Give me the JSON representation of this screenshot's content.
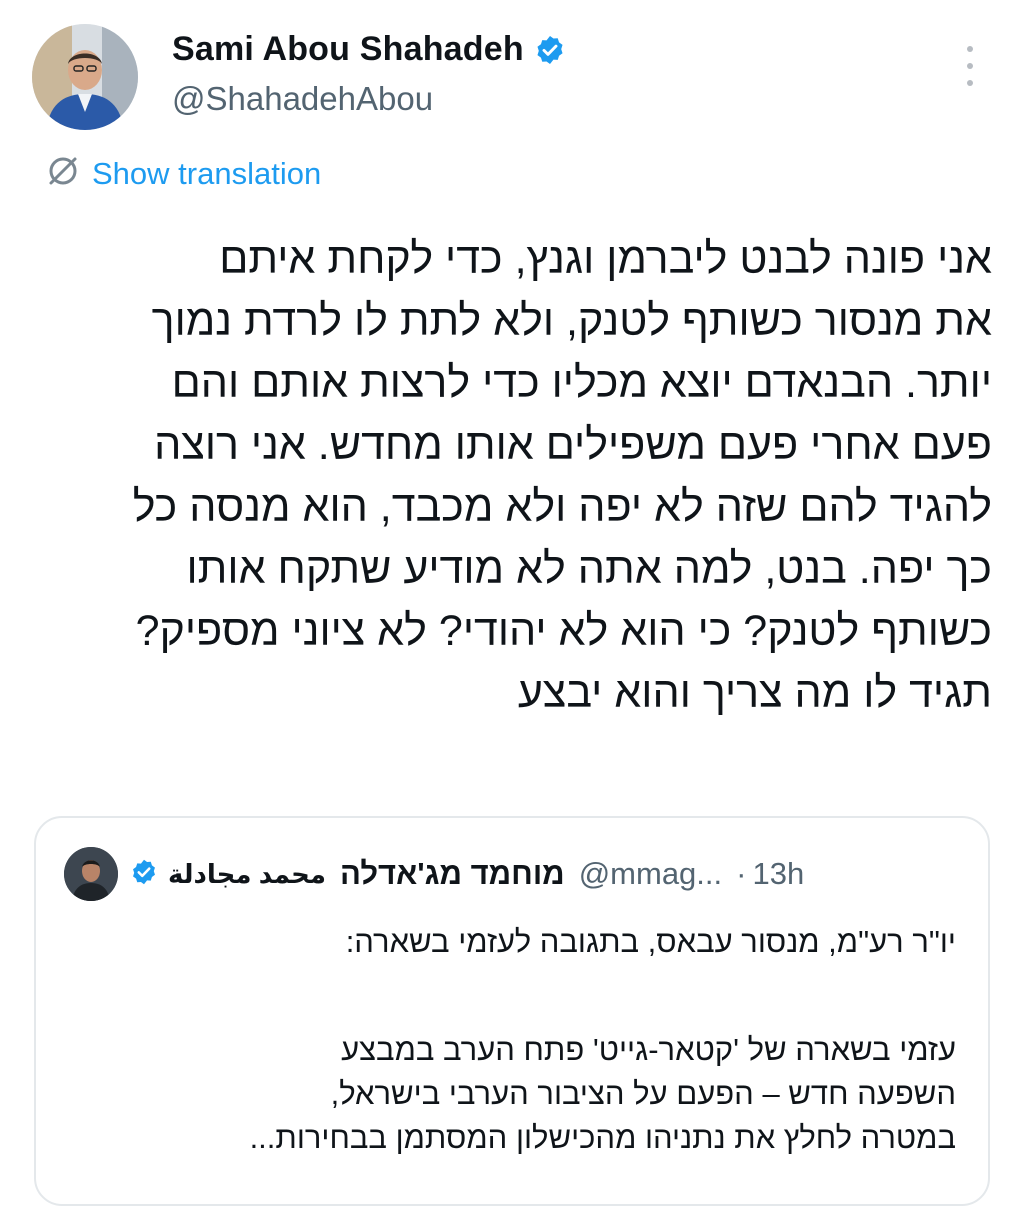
{
  "author": {
    "name": "Sami Abou Shahadeh",
    "handle": "@ShahadehAbou",
    "verified": true,
    "avatar_icon": "profile-photo"
  },
  "menu": {
    "icon": "more-vertical-icon"
  },
  "translate": {
    "label": "Show translation",
    "icon": "translate-icon"
  },
  "tweet": {
    "lines": [
      "אני פונה לבנט ליברמן וגנץ, כדי לקחת איתם",
      "את מנסור כשותף לטנק, ולא לתת לו לרדת נמוך",
      "יותר. הבנאדם יוצא מכליו כדי לרצות אותם והם",
      "פעם אחרי פעם משפילים אותו מחדש. אני רוצה",
      "להגיד להם שזה לא יפה ולא מכבד, הוא מנסה כל",
      "כך יפה.  בנט, למה אתה לא מודיע שתקח אותו",
      "כשותף לטנק? כי הוא לא יהודי? לא ציוני מספיק?",
      "תגיד לו מה צריך והוא יבצע"
    ]
  },
  "quote": {
    "author_hebrew": "מוחמד מג'אדלה",
    "author_arabic": "محمد مجادلة",
    "handle": "@mmag...",
    "separator": "·",
    "time": "13h",
    "verified": true,
    "intro": "יו\"ר רע\"מ, מנסור עבאס, בתגובה לעזמי בשארה:",
    "body_lines": [
      "עזמי בשארה של 'קטאר-גייט' פתח הערב במבצע",
      "השפעה חדש – הפעם על הציבור הערבי בישראל,",
      "במטרה לחלץ את נתניהו מהכישלון המסתמן בבחירות..."
    ]
  },
  "colors": {
    "accent": "#1d9bf0",
    "text": "#0f1419",
    "secondary": "#536471",
    "border": "#e4e8eb"
  }
}
